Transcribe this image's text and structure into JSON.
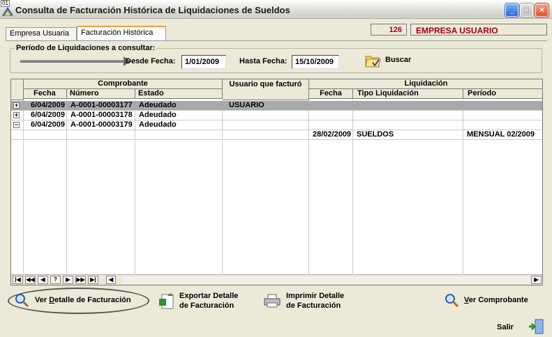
{
  "window": {
    "number_badge": "01",
    "title": "Consulta de Facturación Histórica de Liquidaciones de Sueldos",
    "min_glyph": "_",
    "max_glyph": "□",
    "close_glyph": "×"
  },
  "tabs": [
    {
      "label": "Empresa Usuaria",
      "active": false
    },
    {
      "label": "Facturación Histórica",
      "active": true
    }
  ],
  "company": {
    "code": "126",
    "name": "EMPRESA USUARIO"
  },
  "period": {
    "legend": "Período de Liquidaciones a consultar:",
    "from_label": "Desde Fecha:",
    "from_value": "1/01/2009",
    "to_label": "Hasta Fecha:",
    "to_value": "15/10/2009",
    "search_label": "Buscar"
  },
  "grid": {
    "group_headers": {
      "comprobante": "Comprobante",
      "usuario": "Usuario que facturó",
      "liquidacion": "Liquidación"
    },
    "columns": {
      "fecha": "Fecha",
      "numero": "Número",
      "estado": "Estado",
      "liq_fecha": "Fecha",
      "tipo": "Tipo Liquidación",
      "periodo": "Período"
    },
    "rows": [
      {
        "expander": "+",
        "fecha": "6/04/2009",
        "numero": "A-0001-00003177",
        "estado": "Adeudado",
        "usuario": "USUARIO",
        "selected": true
      },
      {
        "expander": "+",
        "fecha": "6/04/2009",
        "numero": "A-0001-00003178",
        "estado": "Adeudado",
        "usuario": ""
      },
      {
        "expander": "−",
        "fecha": "6/04/2009",
        "numero": "A-0001-00003179",
        "estado": "Adeudado",
        "usuario": ""
      }
    ],
    "detail_row": {
      "liq_fecha": "28/02/2009",
      "tipo": "SUELDOS",
      "periodo": "MENSUAL 02/2009"
    },
    "nav_buttons": [
      "|◀",
      "◀◀",
      "◀",
      "?",
      "▶",
      "▶▶",
      "▶|"
    ]
  },
  "actions": {
    "ver_detalle": {
      "prefix": "Ver ",
      "underlined": "D",
      "suffix": "etalle de Facturación"
    },
    "exportar": {
      "line1": "Exportar Detalle",
      "line2": "de Facturación"
    },
    "imprimir": {
      "line1": "Imprimir Detalle",
      "line2": "de Facturación"
    },
    "ver_comprobante": {
      "underlined": "V",
      "suffix": "er Comprobante"
    },
    "salir": "Salir"
  }
}
